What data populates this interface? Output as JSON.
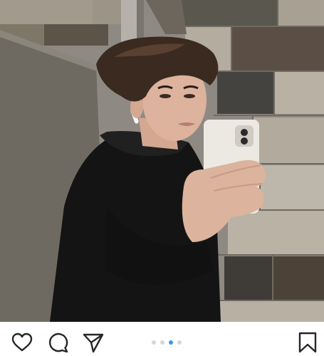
{
  "post": {
    "image": "mirror-selfie-photo",
    "carousel": {
      "count": 4,
      "active_index": 2
    }
  },
  "actions": {
    "like_icon": "heart-icon",
    "comment_icon": "comment-bubble-icon",
    "share_icon": "paper-plane-icon",
    "save_icon": "bookmark-icon"
  },
  "colors": {
    "active_dot": "#3897f0",
    "inactive_dot": "#d6d6d6",
    "icon_stroke": "#262626"
  }
}
